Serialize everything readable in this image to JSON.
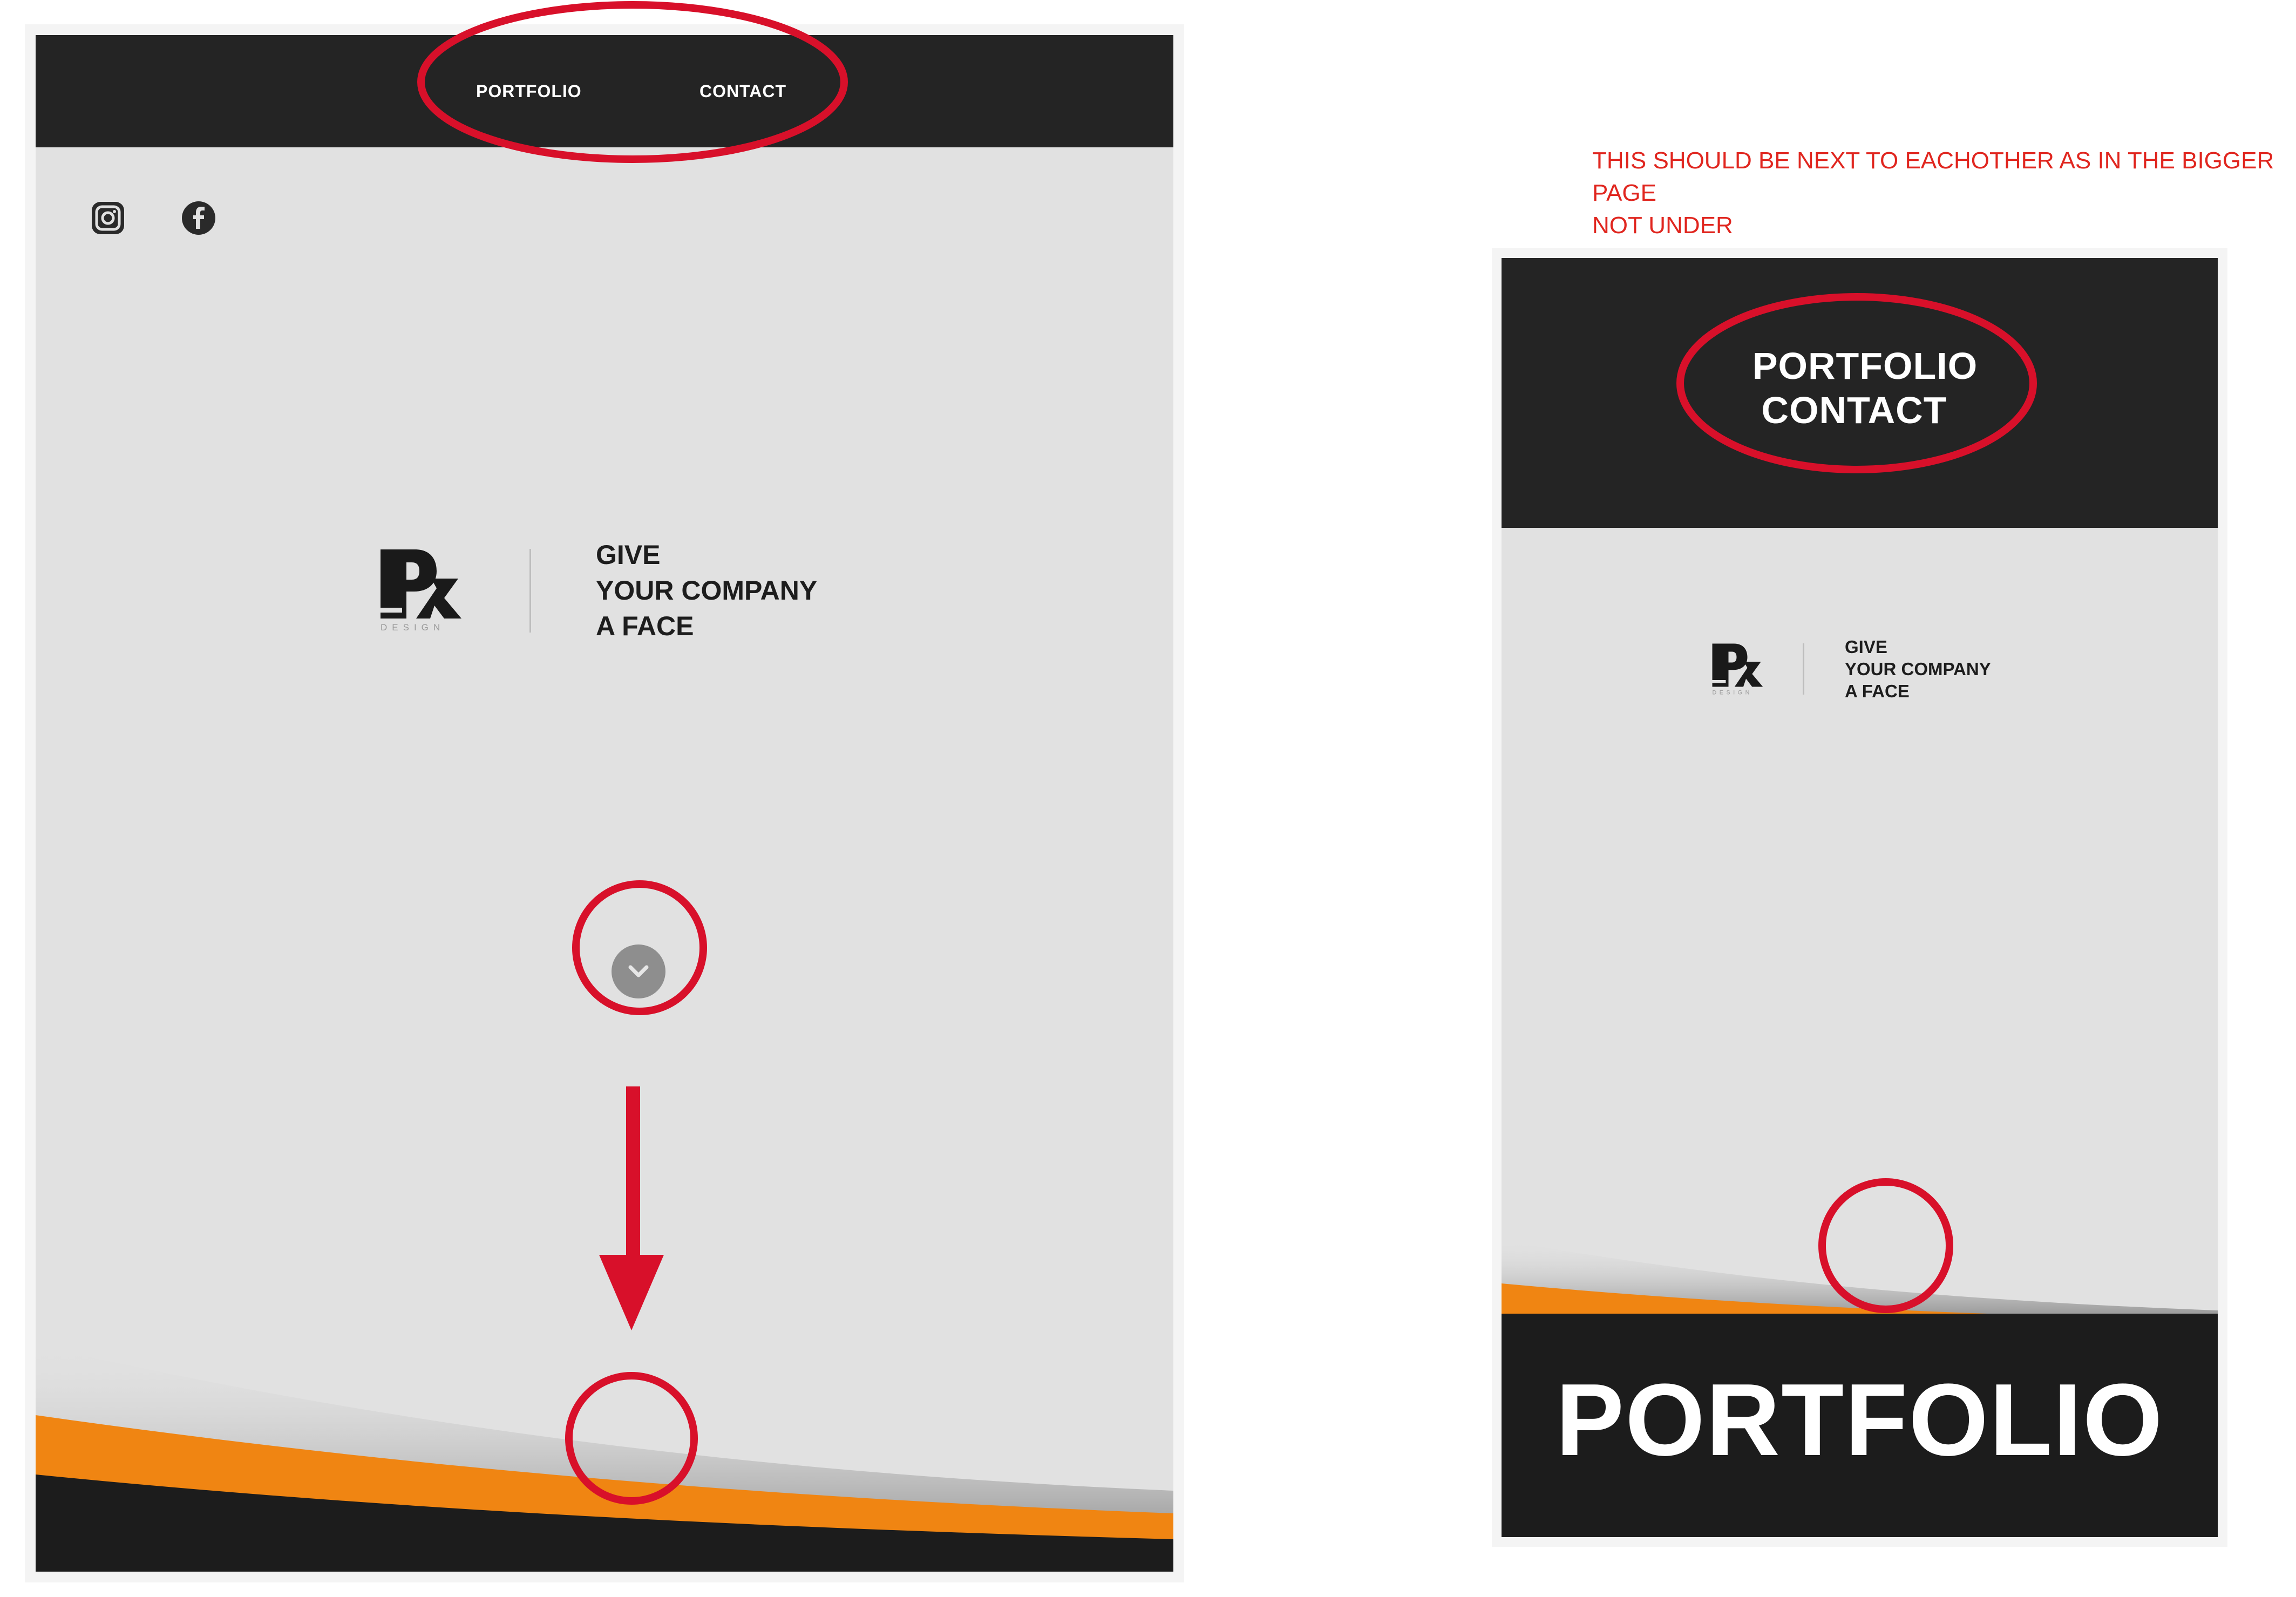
{
  "annotation_note": {
    "line1": "THIS SHOULD BE NEXT TO EACHOTHER AS IN THE BIGGER PAGE",
    "line2": "NOT UNDER",
    "color": "#e0261f"
  },
  "desktop": {
    "nav": {
      "portfolio_label": "PORTFOLIO",
      "contact_label": "CONTACT"
    },
    "social": {
      "icons": [
        "instagram-icon",
        "facebook-icon"
      ]
    },
    "brand": {
      "logo_text": "DESIGN",
      "tagline": [
        "GIVE",
        "YOUR COMPANY",
        "A FACE"
      ]
    },
    "scroll_button_icon": "chevron-down-icon"
  },
  "mobile": {
    "nav": {
      "portfolio_label": "PORTFOLIO",
      "contact_label": "CONTACT"
    },
    "brand": {
      "logo_text": "DESIGN",
      "tagline": [
        "GIVE",
        "YOUR COMPANY",
        "A FACE"
      ]
    },
    "section_heading": "PORTFOLIO",
    "scroll_button_icon": "chevron-down-icon"
  },
  "colors": {
    "nav_background": "#242424",
    "page_background": "#e1e1e1",
    "accent_orange": "#f08512",
    "annotation_red": "#d8102a"
  }
}
